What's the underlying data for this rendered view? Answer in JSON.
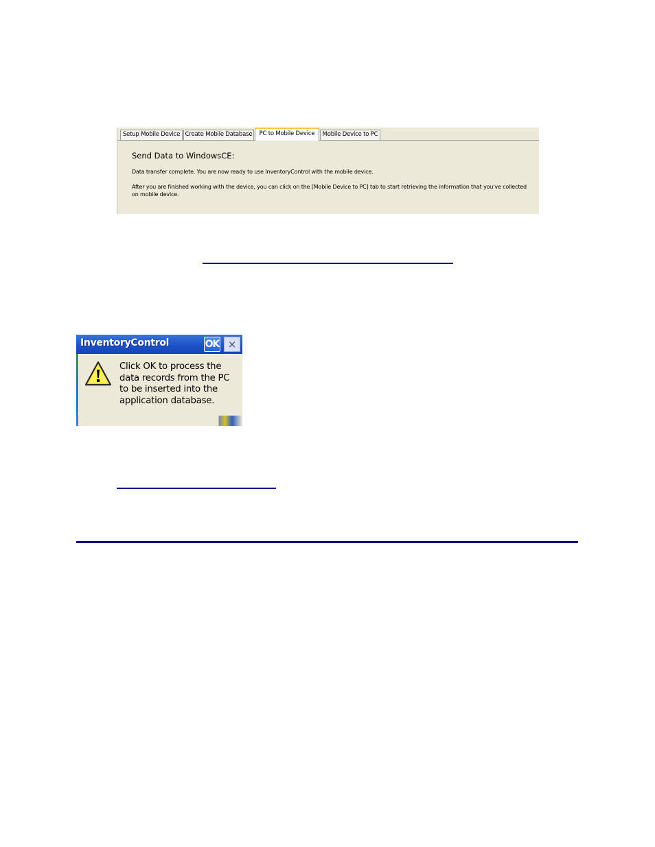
{
  "tab_panel": {
    "tabs": [
      {
        "label": "Setup Mobile Device",
        "active": false
      },
      {
        "label": "Create Mobile Database",
        "active": false
      },
      {
        "label": "PC to Mobile Device",
        "active": true
      },
      {
        "label": "Mobile Device to PC",
        "active": false
      }
    ],
    "title": "Send Data to WindowsCE:",
    "status_text": "Data transfer complete. You are now ready to use InventoryControl with the mobile device.",
    "instructions_line1": "After you are finished working with the device, you can click on the [Mobile Device to PC] tab to start retrieving the information that you've collected",
    "instructions_line2": "on mobile device."
  },
  "dialog": {
    "title": "InventoryControl",
    "ok_label": "OK",
    "close_glyph": "×",
    "icon": "warning-icon",
    "message_lines": [
      "Click OK to process the",
      "data records from the PC",
      "to be inserted into the",
      "application database."
    ]
  },
  "colors": {
    "rule": "#000080",
    "panel_bg": "#ece9d8",
    "titlebar": "#1b4fc8",
    "active_tab_accent": "#ffc83c"
  }
}
